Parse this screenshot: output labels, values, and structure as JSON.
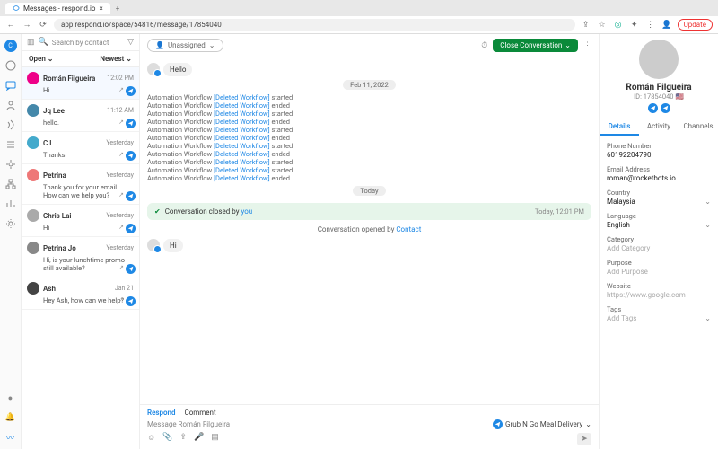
{
  "browser": {
    "tab_title": "Messages - respond.io",
    "url": "app.respond.io/space/54816/message/17854040",
    "update_btn": "Update"
  },
  "rail": {
    "avatar": "C"
  },
  "convlist": {
    "search_placeholder": "Search by contact",
    "filter_open": "Open",
    "filter_sort": "Newest",
    "items": [
      {
        "name": "Román Filgueira",
        "time": "12:02 PM",
        "preview": "Hi",
        "av": "#e08"
      },
      {
        "name": "Jq Lee",
        "time": "11:12 AM",
        "preview": "hello.",
        "av": "#48a"
      },
      {
        "name": "C L",
        "time": "Yesterday",
        "preview": "Thanks",
        "av": "#4ac"
      },
      {
        "name": "Petrina",
        "time": "Yesterday",
        "preview": "Thank you for your email. How can we help you?",
        "av": "#e77"
      },
      {
        "name": "Chris Lai",
        "time": "Yesterday",
        "preview": "Hi",
        "av": "#aaa"
      },
      {
        "name": "Petrina Jo",
        "time": "Yesterday",
        "preview": "Hi, is your lunchtime promo still available?",
        "av": "#888"
      },
      {
        "name": "Ash",
        "time": "Jan 21",
        "preview": "Hey Ash, how can we help?",
        "av": "#444"
      }
    ]
  },
  "chat": {
    "assignee": "Unassigned",
    "close_btn": "Close Conversation",
    "hello": "Hello",
    "hi": "Hi",
    "date1": "Feb 11, 2022",
    "date2": "Today",
    "wf_prefix": "Automation Workflow ",
    "wf_link": "[Deleted Workflow]",
    "wf_states": [
      "started",
      "ended",
      "started",
      "ended",
      "started",
      "ended",
      "started",
      "ended",
      "started",
      "started",
      "ended"
    ],
    "closed_pre": "Conversation closed by ",
    "closed_by": "you",
    "closed_time": "Today, 12:01 PM",
    "opened_pre": "Conversation opened by ",
    "opened_by": "Contact",
    "tab_respond": "Respond",
    "tab_comment": "Comment",
    "input_placeholder": "Message Román Filgueira",
    "channel": "Grub N Go Meal Delivery"
  },
  "side": {
    "name": "Román Filgueira",
    "id": "ID: 17854040",
    "tabs": {
      "details": "Details",
      "activity": "Activity",
      "channels": "Channels"
    },
    "fields": {
      "phone_l": "Phone Number",
      "phone_v": "60192204790",
      "email_l": "Email Address",
      "email_v": "roman@rocketbots.io",
      "country_l": "Country",
      "country_v": "Malaysia",
      "lang_l": "Language",
      "lang_v": "English",
      "cat_l": "Category",
      "cat_ph": "Add Category",
      "purpose_l": "Purpose",
      "purpose_ph": "Add Purpose",
      "web_l": "Website",
      "web_ph": "https://www.google.com",
      "tags_l": "Tags",
      "tags_ph": "Add Tags"
    }
  }
}
